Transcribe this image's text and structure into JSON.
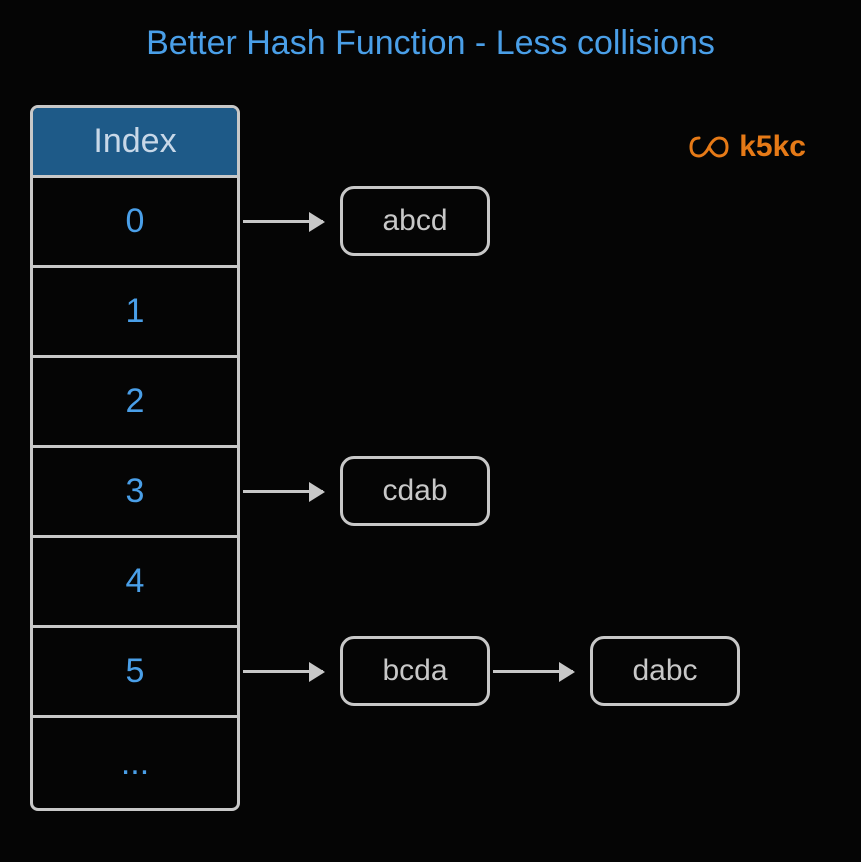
{
  "title": "Better Hash Function - Less collisions",
  "logo": {
    "text": "k5kc"
  },
  "table": {
    "header": "Index",
    "rows": [
      "0",
      "1",
      "2",
      "3",
      "4",
      "5",
      "..."
    ]
  },
  "buckets": {
    "0": [
      "abcd"
    ],
    "3": [
      "cdab"
    ],
    "5": [
      "bcda",
      "dabc"
    ]
  }
}
